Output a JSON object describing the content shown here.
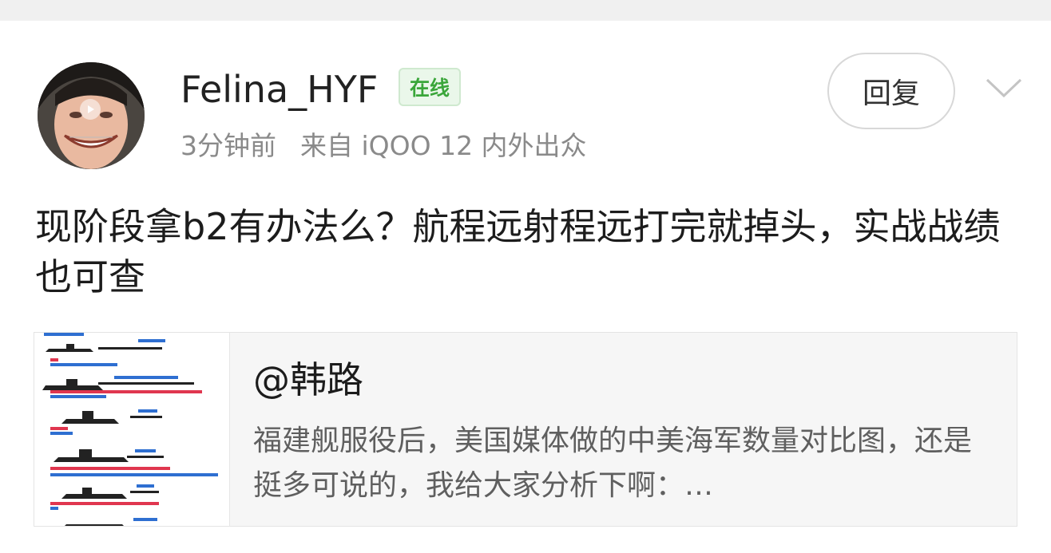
{
  "post": {
    "username": "Felina_HYF",
    "online_badge": "在线",
    "time": "3分钟前",
    "source": "来自 iQOO 12 内外出众",
    "reply_label": "回复",
    "body": "现阶段拿b2有办法么？航程远射程远打完就掉头，实战战绩也可查"
  },
  "share": {
    "title": "@韩路",
    "description": "福建舰服役后，美国媒体做的中美海军数量对比图，还是挺多可说的，我给大家分析下啊：…"
  },
  "colors": {
    "online_green": "#3aa63a",
    "thumbnail_red": "#e0364f",
    "thumbnail_blue": "#2e6fd1"
  }
}
